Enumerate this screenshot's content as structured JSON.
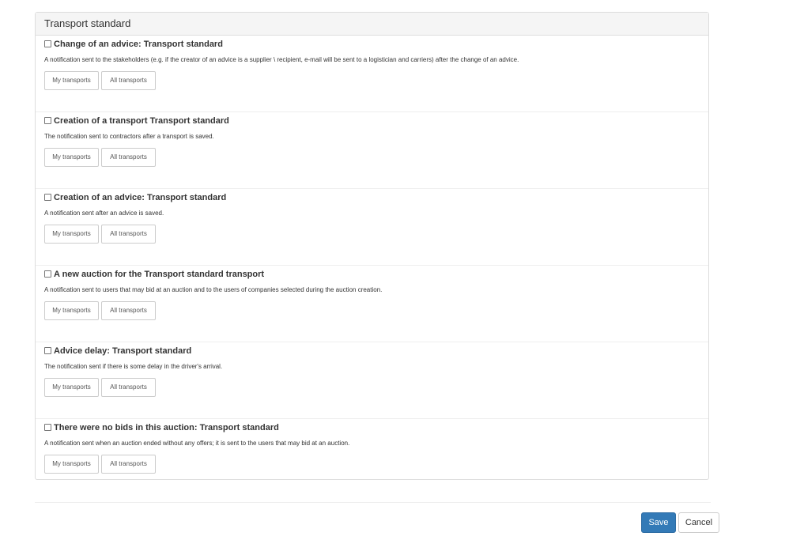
{
  "panel": {
    "title": "Transport standard"
  },
  "notifications": [
    {
      "title": "Change of an advice: Transport standard",
      "description": "A notification sent to the stakeholders (e.g. if the creator of an advice is a supplier \\ recipient, e-mail will be sent to a logistician and carriers) after the change of an advice.",
      "checked": false,
      "my_label": "My transports",
      "all_label": "All transports"
    },
    {
      "title": "Creation of a transport Transport standard",
      "description": "The notification sent to contractors after a transport is saved.",
      "checked": false,
      "my_label": "My transports",
      "all_label": "All transports"
    },
    {
      "title": "Creation of an advice: Transport standard",
      "description": "A notification sent after an advice is saved.",
      "checked": false,
      "my_label": "My transports",
      "all_label": "All transports"
    },
    {
      "title": "A new auction for the Transport standard transport",
      "description": "A notification sent to users that may bid at an auction and to the users of companies selected during the auction creation.",
      "checked": false,
      "my_label": "My transports",
      "all_label": "All transports"
    },
    {
      "title": "Advice delay: Transport standard",
      "description": "The notification sent if there is some delay in the driver's arrival.",
      "checked": false,
      "my_label": "My transports",
      "all_label": "All transports"
    },
    {
      "title": "There were no bids in this auction: Transport standard",
      "description": "A notification sent when an auction ended without any offers; it is sent to the users that may bid at an auction.",
      "checked": false,
      "my_label": "My transports",
      "all_label": "All transports"
    }
  ],
  "footer": {
    "save_label": "Save",
    "cancel_label": "Cancel"
  },
  "colors": {
    "primary": "#337ab7",
    "panel_heading_bg": "#f5f5f5",
    "border": "#dddddd"
  }
}
